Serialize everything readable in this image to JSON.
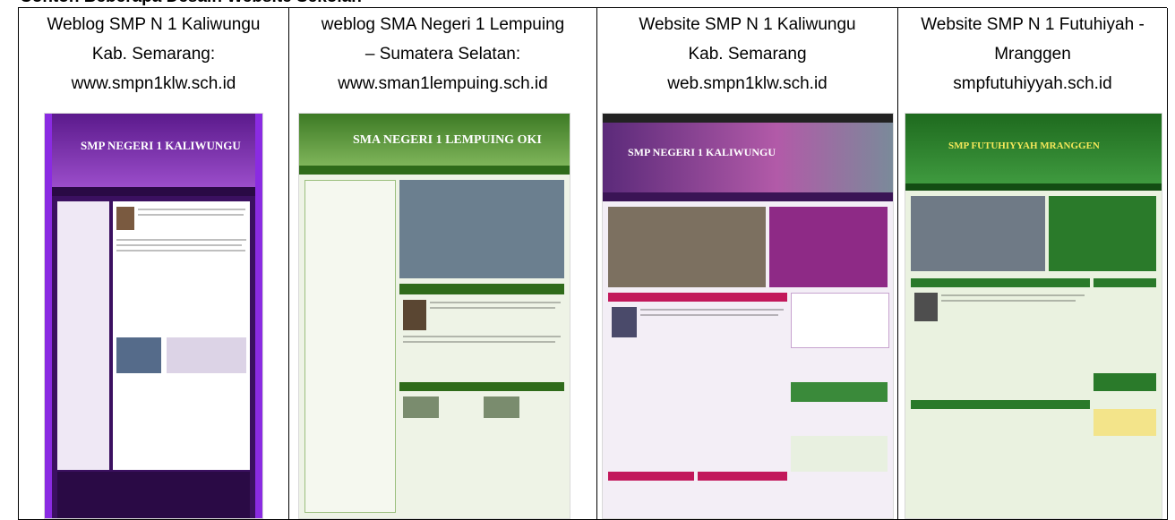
{
  "heading": "Contoh Beberapa Desain Website Sekolah",
  "columns": [
    {
      "lines": [
        "Weblog SMP N 1 Kaliwungu",
        "Kab. Semarang:",
        "www.smpn1klw.sch.id"
      ],
      "screenshot": {
        "banner": "SMP NEGERI 1 KALIWUNGU",
        "theme": "#5b1a8c",
        "accent": "#8a2be2"
      }
    },
    {
      "lines": [
        "weblog SMA Negeri 1 Lempuing",
        "– Sumatera Selatan:",
        "www.sman1lempuing.sch.id"
      ],
      "screenshot": {
        "banner": "SMA NEGERI 1 LEMPUING OKI",
        "theme": "#2f6b1a",
        "accent": "#6aa84f"
      }
    },
    {
      "lines": [
        "Website SMP N 1 Kaliwungu",
        "Kab. Semarang",
        "web.smpn1klw.sch.id"
      ],
      "screenshot": {
        "banner": "SMP NEGERI 1 KALIWUNGU",
        "theme": "#4a1f6b",
        "accent": "#c2185b"
      }
    },
    {
      "lines": [
        "Website SMP N 1 Futuhiyah -",
        "Mranggen",
        "smpfutuhiyyah.sch.id"
      ],
      "screenshot": {
        "banner": "SMP FUTUHIYYAH MRANGGEN",
        "theme": "#1e6a1e",
        "accent": "#d4c21a"
      }
    }
  ]
}
